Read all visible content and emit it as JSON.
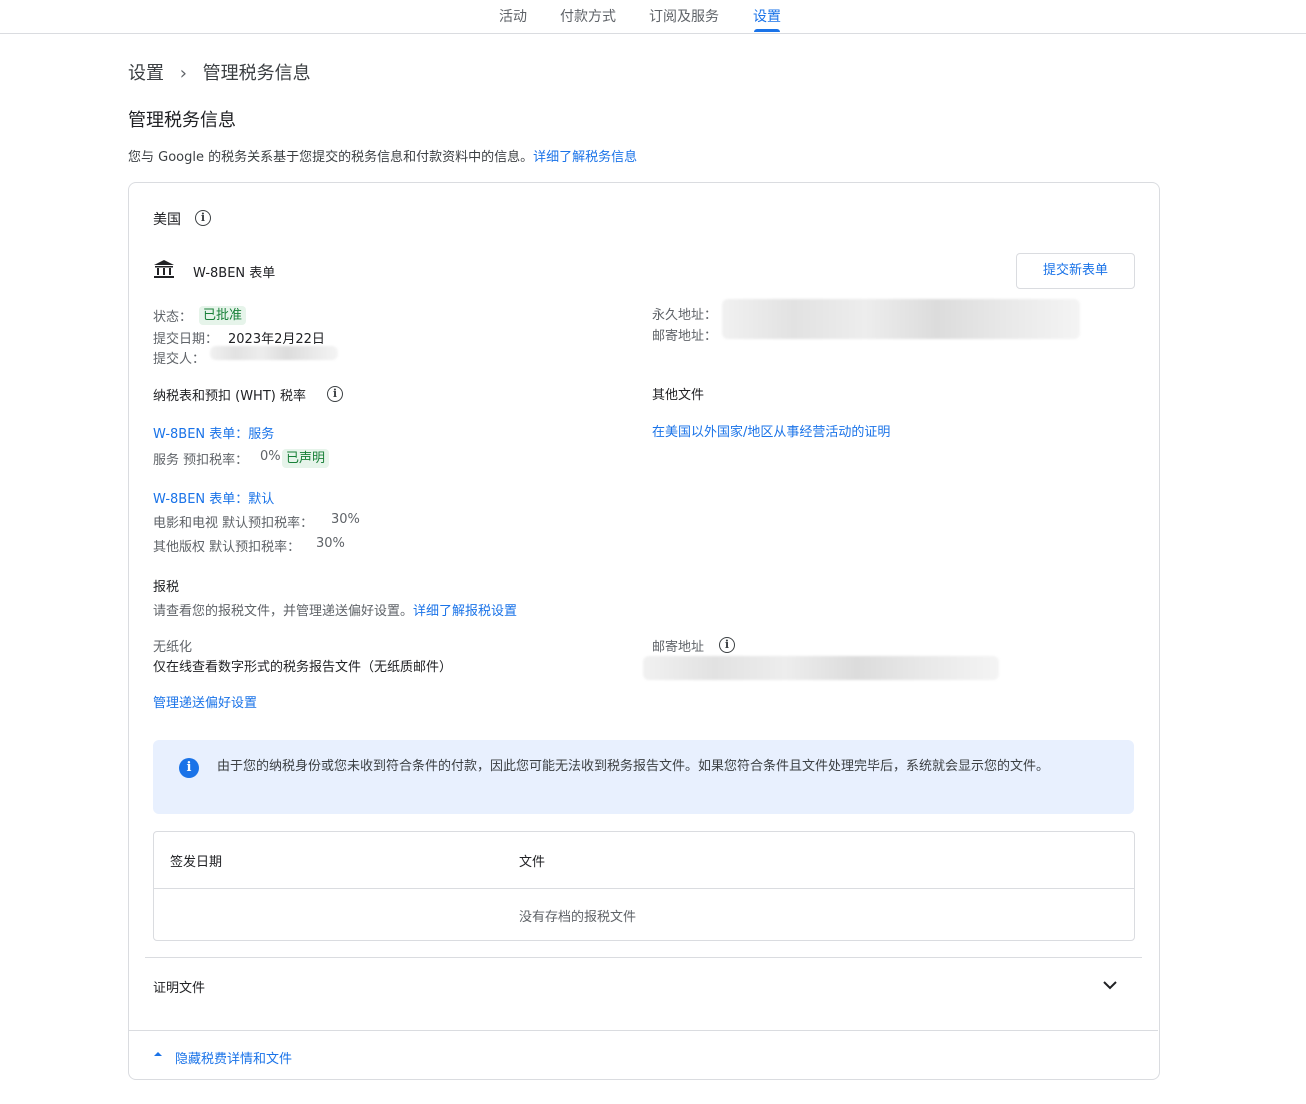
{
  "tabs": [
    {
      "label": "活动"
    },
    {
      "label": "付款方式"
    },
    {
      "label": "订阅及服务"
    },
    {
      "label": "设置"
    }
  ],
  "breadcrumb": {
    "parent": "设置",
    "separator": "›",
    "current": "管理税务信息"
  },
  "page_title": "管理税务信息",
  "intro": {
    "text": "您与 Google 的税务关系基于您提交的税务信息和付款资料中的信息。",
    "link": "详细了解税务信息"
  },
  "card": {
    "country": "美国",
    "form": {
      "title": "W-8BEN 表单",
      "submit_button": "提交新表单",
      "status_label": "状态：",
      "status_value": "已批准",
      "date_label": "提交日期：",
      "date_value": "2023年2月22日",
      "submitter_label": "提交人：",
      "permanent_address_label": "永久地址：",
      "mailing_address_label": "邮寄地址："
    },
    "wht": {
      "heading": "纳税表和预扣 (WHT) 税率",
      "service_link": "W-8BEN 表单：服务",
      "service_rate_label": "服务 预扣税率：",
      "service_rate_value": "0%",
      "service_badge": "已声明",
      "default_link": "W-8BEN 表单：默认",
      "film_tv": "电影和电视 默认预扣税率：",
      "film_tv_value": "30%",
      "other_royalties": "其他版权 默认预扣税率：",
      "other_royalties_value": "30%"
    },
    "other_docs": {
      "heading": "其他文件",
      "link": "在美国以外国家/地区从事经营活动的证明"
    },
    "tax_reporting": {
      "heading": "报税",
      "desc": "请查看您的报税文件，并管理递送偏好设置。",
      "desc_link": "详细了解报税设置",
      "paperless_label": "无纸化",
      "paperless_value": "仅在线查看数字形式的税务报告文件（无纸质邮件）",
      "mailing_label": "邮寄地址",
      "manage_link": "管理递送偏好设置"
    },
    "notice": "由于您的纳税身份或您未收到符合条件的付款，因此您可能无法收到税务报告文件。如果您符合条件且文件处理完毕后，系统就会显示您的文件。",
    "table": {
      "col_date": "签发日期",
      "col_file": "文件",
      "empty": "没有存档的报税文件"
    },
    "certificates": "证明文件",
    "hide_link": "隐藏税费详情和文件"
  }
}
